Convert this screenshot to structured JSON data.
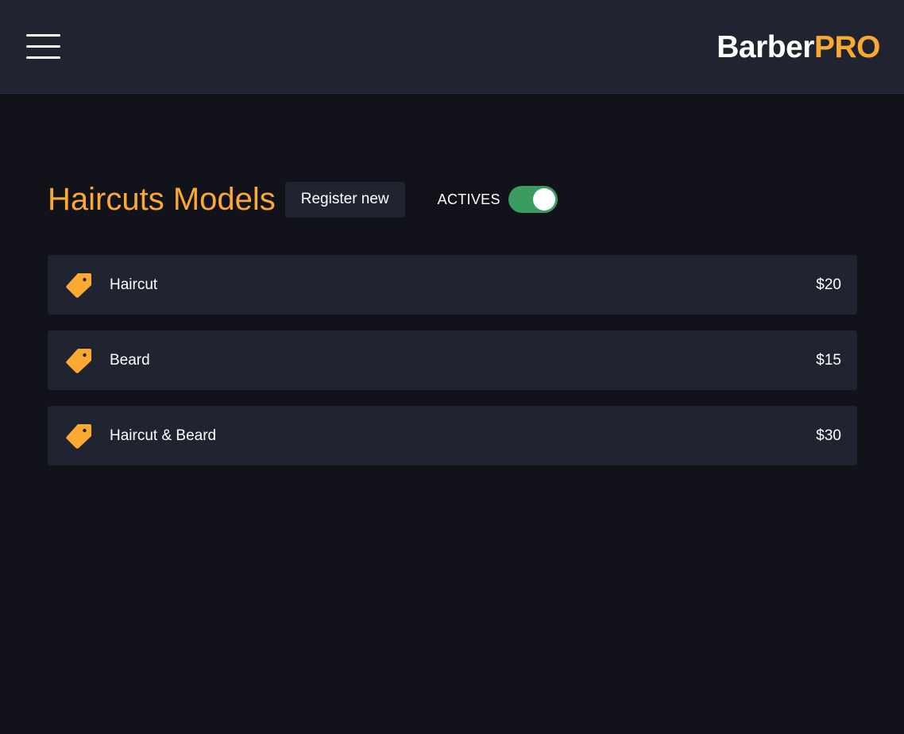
{
  "header": {
    "logo_part1": "Barber",
    "logo_part2": "PRO",
    "menu_icon": "hamburger-menu-icon"
  },
  "page": {
    "title": "Haircuts Models",
    "register_label": "Register new",
    "actives_label": "ACTIVES",
    "actives_toggle_on": true
  },
  "models": [
    {
      "icon": "price-tag-icon",
      "name": "Haircut",
      "price": "$20"
    },
    {
      "icon": "price-tag-icon",
      "name": "Beard",
      "price": "$15"
    },
    {
      "icon": "price-tag-icon",
      "name": "Haircut & Beard",
      "price": "$30"
    }
  ],
  "colors": {
    "background": "#12121b",
    "surface": "#1f2430",
    "accent": "#fba931",
    "toggle_on": "#3a9c5e",
    "text": "#ffffff"
  }
}
